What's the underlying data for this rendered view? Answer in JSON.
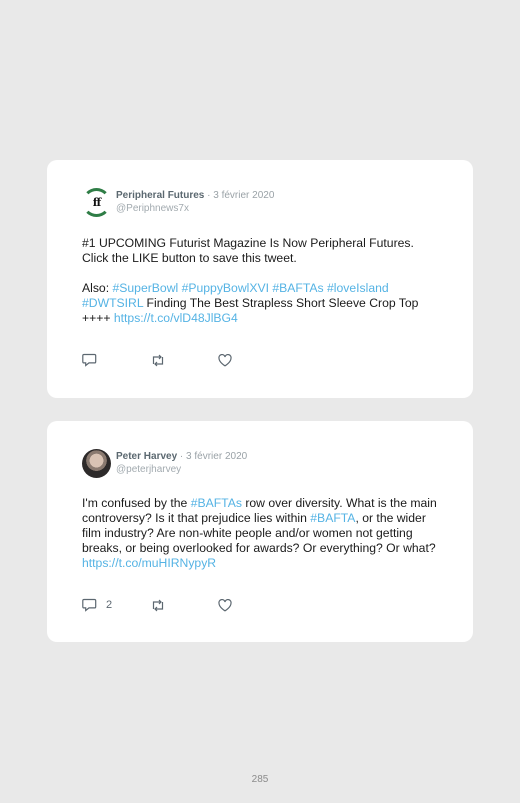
{
  "tweets": [
    {
      "avatar": "peripheral-futures-logo",
      "avatar_text": "ff",
      "name": "Peripheral Futures",
      "date": " · 3 février 2020",
      "handle": "@Periphnews7x",
      "p1": "#1 UPCOMING Futurist Magazine Is Now Peripheral Futures. Click the LIKE button to save this tweet.",
      "p2_lead": "Also: ",
      "p2_tags": "#SuperBowl #PuppyBowlXVI #BAFTAs #loveIsland #DWTSIRL",
      "p2_text": " Finding The Best Strapless Short Sleeve Crop Top ++++ ",
      "p2_link": "https://t.co/vlD48JlBG4",
      "reply_count": ""
    },
    {
      "avatar": "peter-harvey-photo",
      "name": "Peter Harvey",
      "date": " · 3 février 2020",
      "handle": "@peterjharvey",
      "t1": "I'm confused by the ",
      "tag1": "#BAFTAs",
      "t2": " row over diversity. What is the main controversy? Is it that prejudice lies within ",
      "tag2": "#BAFTA",
      "t3": ", or the wider film industry? Are non-white people and/or women not getting breaks, or being overlooked for awards? Or everything? Or what? ",
      "link": "https://t.co/muHIRNypyR",
      "reply_count": "2"
    }
  ],
  "page_number": "285",
  "colors": {
    "link": "#55b3e4",
    "name": "#5b6870",
    "background": "#e9e9e9"
  }
}
